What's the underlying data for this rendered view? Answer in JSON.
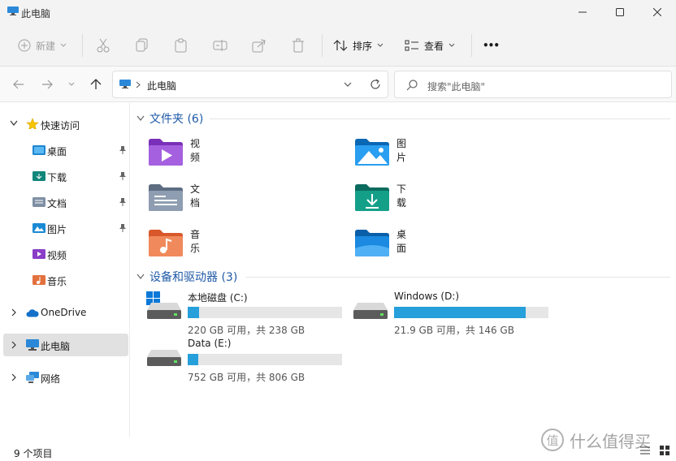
{
  "window": {
    "title": "此电脑"
  },
  "toolbar": {
    "new_label": "新建",
    "sort_label": "排序",
    "view_label": "查看",
    "more_label": "•••"
  },
  "nav": {
    "address_text": "此电脑",
    "search_placeholder": "搜索\"此电脑\""
  },
  "sidebar": {
    "quick_access": "快速访问",
    "items": [
      {
        "label": "桌面",
        "pinned": true
      },
      {
        "label": "下载",
        "pinned": true
      },
      {
        "label": "文档",
        "pinned": true
      },
      {
        "label": "图片",
        "pinned": true
      },
      {
        "label": "视频",
        "pinned": false
      },
      {
        "label": "音乐",
        "pinned": false
      }
    ],
    "onedrive": "OneDrive",
    "this_pc": "此电脑",
    "network": "网络"
  },
  "folders": {
    "header": "文件夹 (6)",
    "items": [
      "视频",
      "图片",
      "文档",
      "下载",
      "音乐",
      "桌面"
    ]
  },
  "drives": {
    "header": "设备和驱动器 (3)",
    "items": [
      {
        "name": "本地磁盘 (C:)",
        "info": "220 GB 可用，共 238 GB",
        "used_fraction": 0.076
      },
      {
        "name": "Windows (D:)",
        "info": "21.9 GB 可用，共 146 GB",
        "used_fraction": 0.85
      },
      {
        "name": "Data (E:)",
        "info": "752 GB 可用，共 806 GB",
        "used_fraction": 0.067
      }
    ]
  },
  "status": {
    "item_count": "9 个项目"
  },
  "watermark": {
    "text": "什么值得买",
    "logo_char": "值"
  },
  "colors": {
    "accent": "#26a0da",
    "section_header": "#1f5aa8"
  }
}
